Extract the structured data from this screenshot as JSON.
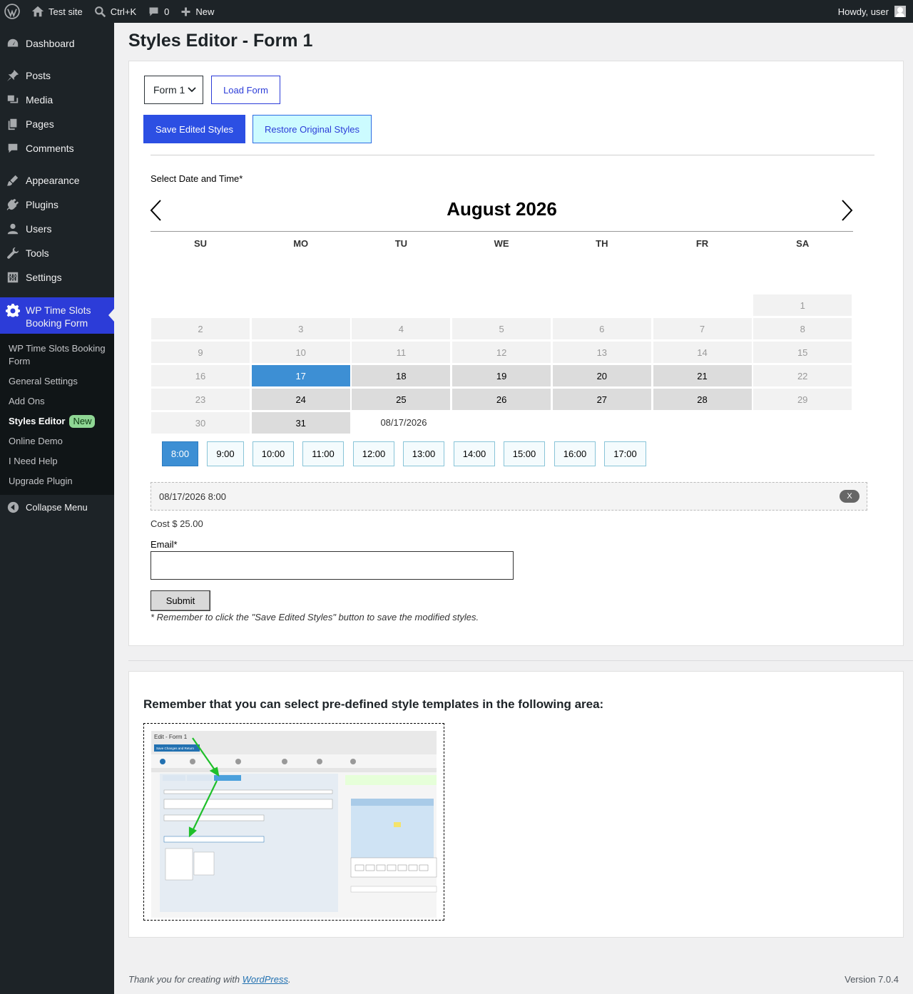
{
  "adminbar": {
    "site_name": "Test site",
    "search_shortcut": "Ctrl+K",
    "comments_count": "0",
    "new_label": "New",
    "howdy": "Howdy, user"
  },
  "sidebar": {
    "items": [
      {
        "label": "Dashboard",
        "icon": "dashboard-icon"
      },
      {
        "label": "Posts",
        "icon": "pin-icon"
      },
      {
        "label": "Media",
        "icon": "media-icon"
      },
      {
        "label": "Pages",
        "icon": "pages-icon"
      },
      {
        "label": "Comments",
        "icon": "comment-icon"
      },
      {
        "label": "Appearance",
        "icon": "brush-icon"
      },
      {
        "label": "Plugins",
        "icon": "plug-icon"
      },
      {
        "label": "Users",
        "icon": "user-icon"
      },
      {
        "label": "Tools",
        "icon": "wrench-icon"
      },
      {
        "label": "Settings",
        "icon": "sliders-icon"
      },
      {
        "label": "WP Time Slots Booking Form",
        "icon": "gear-icon"
      }
    ],
    "submenu": [
      "WP Time Slots Booking Form",
      "General Settings",
      "Add Ons",
      "Styles Editor",
      "Online Demo",
      "I Need Help",
      "Upgrade Plugin"
    ],
    "new_badge": "New",
    "collapse": "Collapse Menu"
  },
  "page": {
    "title": "Styles Editor - Form 1",
    "form_select_value": "Form 1",
    "load_form": "Load Form",
    "save_styles": "Save Edited Styles",
    "restore_styles": "Restore Original Styles"
  },
  "calendar": {
    "field_label": "Select Date and Time*",
    "month_title": "August 2026",
    "weekdays": [
      "SU",
      "MO",
      "TU",
      "WE",
      "TH",
      "FR",
      "SA"
    ],
    "first_weekday_index": 6,
    "days_in_month": 31,
    "selected_day": 17,
    "available_days": [
      17,
      18,
      19,
      20,
      21,
      24,
      25,
      26,
      27,
      28,
      31
    ],
    "selected_date_label": "08/17/2026",
    "slots": [
      "8:00",
      "9:00",
      "10:00",
      "11:00",
      "12:00",
      "13:00",
      "14:00",
      "15:00",
      "16:00",
      "17:00"
    ],
    "active_slot": "8:00",
    "selection_text": "08/17/2026 8:00",
    "clear_label": "X",
    "cost_text": "Cost $ 25.00",
    "email_label": "Email*",
    "submit_label": "Submit",
    "note": "* Remember to click the \"Save Edited Styles\" button to save the modified styles."
  },
  "templates_panel": {
    "title": "Remember that you can select pre-defined style templates in the following area:",
    "screenshot_title": "Edit - Form 1",
    "screenshot_button": "Save Changes and Return"
  },
  "footer": {
    "thanks_prefix": "Thank you for creating with ",
    "wordpress_link": "WordPress",
    "thanks_suffix": ".",
    "version": "Version 7.0.4"
  },
  "colors": {
    "accent": "#2c3cd8",
    "selected_day": "#3d8fd4",
    "sidebar_bg": "#1d2327"
  }
}
